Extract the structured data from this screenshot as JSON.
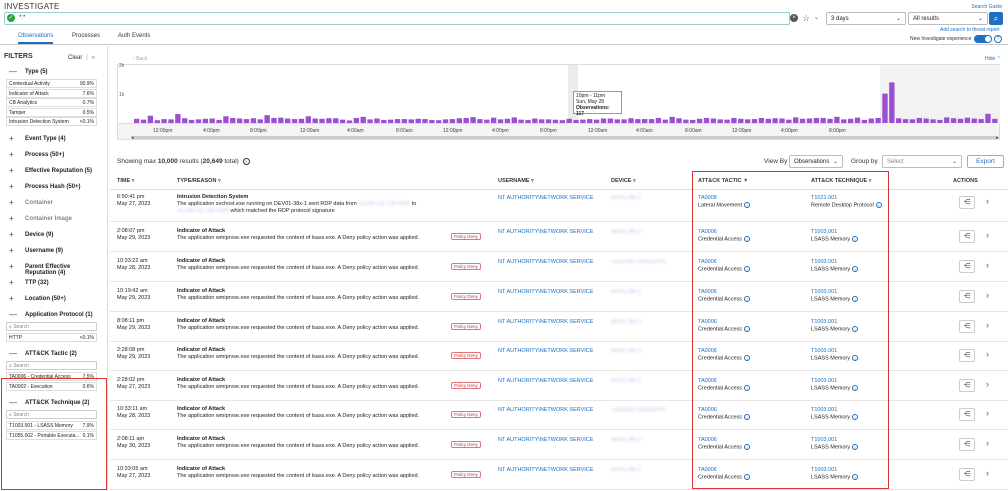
{
  "app_title": "INVESTIGATE",
  "search_guide": "Search Guide",
  "query_text": "*:*",
  "time_range": "3 days",
  "result_filter": "All results",
  "add_search_link": "Add search to threat report",
  "new_exp_label": "New Investigate experience",
  "tabs": [
    "Observations",
    "Processes",
    "Auth Events"
  ],
  "sidebar": {
    "title": "FILTERS",
    "clear": "Clear",
    "sections": [
      {
        "label": "Type (5)",
        "sym": "—",
        "disabled": false,
        "items": [
          {
            "name": "Contextual Activity",
            "pct": "90.9%"
          },
          {
            "name": "Indicator of Attack",
            "pct": "7.6%"
          },
          {
            "name": "CB Analytics",
            "pct": "0.7%"
          },
          {
            "name": "Tamper",
            "pct": "0.5%"
          },
          {
            "name": "Intrusion Detection System",
            "pct": "<0.1%"
          }
        ]
      },
      {
        "label": "Event Type (4)",
        "sym": "+",
        "disabled": false
      },
      {
        "label": "Process (50+)",
        "sym": "+",
        "disabled": false
      },
      {
        "label": "Effective Reputation (5)",
        "sym": "+",
        "disabled": false
      },
      {
        "label": "Process Hash (50+)",
        "sym": "+",
        "disabled": false
      },
      {
        "label": "Container",
        "sym": "+",
        "disabled": true
      },
      {
        "label": "Container Image",
        "sym": "+",
        "disabled": true
      },
      {
        "label": "Device (9)",
        "sym": "+",
        "disabled": false
      },
      {
        "label": "Username (9)",
        "sym": "+",
        "disabled": false
      },
      {
        "label": "Parent Effective Reputation (4)",
        "sym": "+",
        "disabled": false
      },
      {
        "label": "TTP (32)",
        "sym": "+",
        "disabled": false
      },
      {
        "label": "Location (50+)",
        "sym": "+",
        "disabled": false
      },
      {
        "label": "Application Protocol (1)",
        "sym": "—",
        "disabled": false,
        "search": "Search",
        "items": [
          {
            "name": "HTTP",
            "pct": "<0.1%"
          }
        ]
      },
      {
        "label": "ATT&CK Tactic (2)",
        "sym": "—",
        "disabled": false,
        "search": "Search",
        "items": [
          {
            "name": "TA0006 - Credential Access",
            "pct": "7.5%"
          },
          {
            "name": "TA0002 - Execution",
            "pct": "0.6%"
          }
        ]
      },
      {
        "label": "ATT&CK Technique (2)",
        "sym": "—",
        "disabled": false,
        "search": "Search",
        "items": [
          {
            "name": "T1003.001 - LSASS Memory",
            "pct": "7.9%"
          },
          {
            "name": "T1055.002 - Portable Executa...",
            "pct": "0.1%"
          }
        ]
      }
    ]
  },
  "chart": {
    "back_label": "Back",
    "hide_label": "Hide",
    "y_ticks": [
      "2k",
      "1k"
    ],
    "x_ticks": [
      "12:00pm",
      "4:00pm",
      "8:00pm",
      "12:00am",
      "4:00am",
      "8:00am",
      "12:00pm",
      "4:00pm",
      "8:00pm",
      "12:00am",
      "4:00am",
      "8:00am",
      "12:00pm",
      "4:00pm",
      "8:00pm"
    ],
    "tooltip": {
      "range": "10pm - 11pm",
      "date": "Sun, May 28",
      "obs_label": "Observations:",
      "obs_value": "117"
    }
  },
  "chart_data": {
    "type": "bar",
    "ylim": [
      0,
      2000
    ],
    "values": [
      150,
      120,
      260,
      100,
      140,
      130,
      320,
      170,
      110,
      130,
      150,
      160,
      110,
      240,
      180,
      160,
      140,
      170,
      130,
      280,
      180,
      190,
      160,
      140,
      150,
      240,
      160,
      150,
      170,
      170,
      120,
      90,
      180,
      220,
      130,
      160,
      110,
      120,
      140,
      140,
      130,
      150,
      140,
      110,
      100,
      130,
      140,
      170,
      180,
      210,
      140,
      120,
      190,
      130,
      150,
      200,
      120,
      110,
      160,
      130,
      130,
      117,
      100,
      150,
      110,
      120,
      140,
      120,
      160,
      160,
      130,
      130,
      170,
      140,
      140,
      140,
      180,
      120,
      220,
      170,
      120,
      110,
      150,
      180,
      160,
      130,
      120,
      180,
      150,
      130,
      140,
      180,
      150,
      170,
      160,
      120,
      200,
      150,
      160,
      180,
      180,
      150,
      220,
      130,
      150,
      190,
      110,
      160,
      180,
      1050,
      1450,
      170,
      140,
      130,
      180,
      160,
      130,
      110,
      200,
      170,
      150,
      190,
      160,
      140,
      330,
      150
    ]
  },
  "results": {
    "showing_prefix": "Showing max",
    "showing_max": "10,000",
    "showing_mid": "results (",
    "showing_total": "20,649",
    "showing_suffix": "total)",
    "view_by_label": "View By",
    "view_by_value": "Observations",
    "group_by_label": "Group by",
    "group_by_placeholder": "Select",
    "export_label": "Export"
  },
  "columns": [
    "TIME",
    "TYPE/REASON",
    "USERNAME",
    "DEVICE",
    "ATT&CK TACTIC",
    "ATT&CK TECHNIQUE",
    "ACTIONS"
  ],
  "rows": [
    {
      "time": "6:50:41 pm",
      "date": "May 27, 2023",
      "type": "Intrusion Detection System",
      "desc1": "The application svchost.exe running on DEV01-38x-1 sent RDP data from",
      "desc_hidden": "10.240.101.100 5000",
      "desc1b": "to",
      "desc2_hidden": "10.240.101.100 5000",
      "desc2": "which matched the RDP protocol signature",
      "pill": "",
      "user": "NT AUTHORITY\\NETWORK SERVICE",
      "device": "dev01-38x-1",
      "tactic_id": "TA0008",
      "tactic_name": "Lateral Movement",
      "tech_id": "T1021.001",
      "tech_name": "Remote Desktop Protocol"
    },
    {
      "time": "2:08:07 pm",
      "date": "May 29, 2023",
      "type": "Indicator of Attack",
      "desc1": "The application wmiprvse.exe requested the content of lsass.exe. A Deny policy action was applied.",
      "pill": "Policy Deny",
      "user": "NT AUTHORITY\\NETWORK SERVICE",
      "device": "dev01-38x-1",
      "tactic_id": "TA0006",
      "tactic_name": "Credential Access",
      "tech_id": "T1003.001",
      "tech_name": "LSASS Memory"
    },
    {
      "time": "10:33:22 am",
      "date": "May 28, 2023",
      "type": "Indicator of Attack",
      "desc1": "The application wmiprvse.exe requested the content of lsass.exe. A Deny policy action was applied.",
      "pill": "Policy Deny",
      "user": "NT AUTHORITY\\NETWORK SERVICE",
      "device": "corporate-hostname01",
      "tactic_id": "TA0006",
      "tactic_name": "Credential Access",
      "tech_id": "T1003.001",
      "tech_name": "LSASS Memory"
    },
    {
      "time": "10:19:42 am",
      "date": "May 29, 2023",
      "type": "Indicator of Attack",
      "desc1": "The application wmiprvse.exe requested the content of lsass.exe. A Deny policy action was applied.",
      "pill": "Policy Deny",
      "user": "NT AUTHORITY\\NETWORK SERVICE",
      "device": "dev01-38x-1",
      "tactic_id": "TA0006",
      "tactic_name": "Credential Access",
      "tech_id": "T1003.001",
      "tech_name": "LSASS Memory"
    },
    {
      "time": "8:08:11 pm",
      "date": "May 29, 2023",
      "type": "Indicator of Attack",
      "desc1": "The application wmiprvse.exe requested the content of lsass.exe. A Deny policy action was applied.",
      "pill": "Policy Deny",
      "user": "NT AUTHORITY\\NETWORK SERVICE",
      "device": "dev01-38x-1",
      "tactic_id": "TA0006",
      "tactic_name": "Credential Access",
      "tech_id": "T1003.001",
      "tech_name": "LSASS Memory"
    },
    {
      "time": "2:28:08 pm",
      "date": "May 29, 2023",
      "type": "Indicator of Attack",
      "desc1": "The application wmiprvse.exe requested the content of lsass.exe. A Deny policy action was applied.",
      "pill": "Policy Deny",
      "user": "NT AUTHORITY\\NETWORK SERVICE",
      "device": "dev01-38x-1",
      "tactic_id": "TA0006",
      "tactic_name": "Credential Access",
      "tech_id": "T1003.001",
      "tech_name": "LSASS Memory"
    },
    {
      "time": "2:28:02 pm",
      "date": "May 27, 2023",
      "type": "Indicator of Attack",
      "desc1": "The application wmiprvse.exe requested the content of lsass.exe. A Deny policy action was applied.",
      "pill": "Policy Deny",
      "user": "NT AUTHORITY\\NETWORK SERVICE",
      "device": "dev01-38x-1",
      "tactic_id": "TA0006",
      "tactic_name": "Credential Access",
      "tech_id": "T1003.001",
      "tech_name": "LSASS Memory"
    },
    {
      "time": "10:33:11 am",
      "date": "May 28, 2023",
      "type": "Indicator of Attack",
      "desc1": "The application wmiprvse.exe requested the content of lsass.exe. A Deny policy action was applied.",
      "pill": "Policy Deny",
      "user": "NT AUTHORITY\\NETWORK SERVICE",
      "device": "corporate-hostname01",
      "tactic_id": "TA0006",
      "tactic_name": "Credential Access",
      "tech_id": "T1003.001",
      "tech_name": "LSASS Memory"
    },
    {
      "time": "2:08:11 am",
      "date": "May 30, 2023",
      "type": "Indicator of Attack",
      "desc1": "The application wmiprvse.exe requested the content of lsass.exe. A Deny policy action was applied.",
      "pill": "Policy Deny",
      "user": "NT AUTHORITY\\NETWORK SERVICE",
      "device": "dev01-38x-1",
      "tactic_id": "TA0006",
      "tactic_name": "Credential Access",
      "tech_id": "T1003.001",
      "tech_name": "LSASS Memory"
    },
    {
      "time": "10:33:05 am",
      "date": "May 27, 2023",
      "type": "Indicator of Attack",
      "desc1": "The application wmiprvse.exe requested the content of lsass.exe. A Deny policy action was applied.",
      "pill": "Policy Deny",
      "user": "NT AUTHORITY\\NETWORK SERVICE",
      "device": "dev01-38x-1",
      "tactic_id": "TA0006",
      "tactic_name": "Credential Access",
      "tech_id": "T1003.001",
      "tech_name": "LSASS Memory"
    }
  ],
  "colors": {
    "accent": "#1a6fc4",
    "bar": "#9b4fd1",
    "highlight": "#d33333"
  }
}
